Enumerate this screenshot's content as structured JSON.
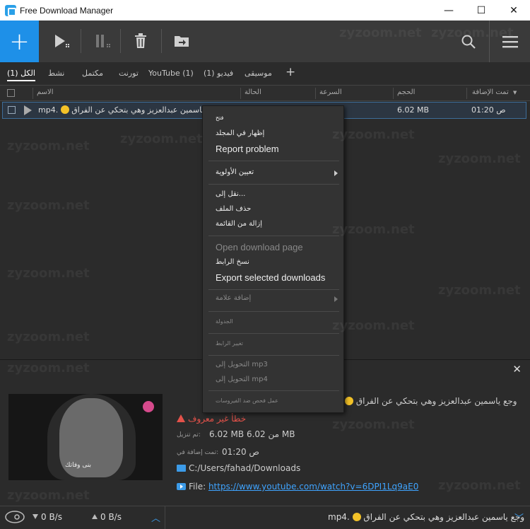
{
  "window": {
    "title": "Free Download Manager",
    "minimize": "—",
    "maximize": "☐",
    "close": "✕"
  },
  "toolbar": {
    "add_label": "+"
  },
  "filters": [
    {
      "label": "الكل (1)",
      "active": true
    },
    {
      "label": "نشط"
    },
    {
      "label": "مكتمل"
    },
    {
      "label": "تورنت"
    },
    {
      "label": "YouTube (1)"
    },
    {
      "label": "(1) فيديو"
    },
    {
      "label": "موسيقى"
    }
  ],
  "filter_add": "+",
  "columns": {
    "name": "الاسم",
    "status": "الحالة",
    "speed": "السرعة",
    "size": "الحجم",
    "added": "تمت الإضافة"
  },
  "row": {
    "name_prefix": "mp4.",
    "name_text": "بع ياسمين عبدالعزيز وهي بتحكي عن الفراق",
    "size": "6.02 MB",
    "added": "01:20 ص"
  },
  "context_menu": {
    "open": "فتح",
    "show_in_folder": "إظهار في المجلد",
    "report_problem": "Report problem",
    "set_priority": "تعيين الأولوية",
    "move_to": "نقل إلى...",
    "delete_file": "حذف الملف",
    "remove_from_list": "إزالة من القائمة",
    "open_download_page": "Open download page",
    "copy_link": "نسخ الرابط",
    "export_selected": "Export selected downloads",
    "add_tag": "إضافة علامة",
    "schedule": "الجدولة",
    "change_link": "تغيير الرابط",
    "convert_mp3": "التحويل إلى mp3",
    "convert_mp4": "التحويل إلى mp4",
    "virus_check": "عمل فحص ضد الفيروسات"
  },
  "details": {
    "title_text": "وجع ياسمين عبدالعزيز وهي بتحكي عن الفراق",
    "close": "✕",
    "error": "خطأ غير معروف",
    "downloaded_label": "تم تنزيل:",
    "downloaded_value": "6.02 MB من 6.02 MB",
    "added_label": "تمت إضافة في:",
    "added_value": "01:20 ص",
    "path": "C:/Users/fahad/Downloads",
    "file_label": "File:",
    "file_url": "https://www.youtube.com/watch?v=6DPI1Lq9aE0",
    "thumb_caption": "بنى وفاتك"
  },
  "statusbar": {
    "down_speed": "0 B/s",
    "up_speed": "0 B/s",
    "current_file_prefix": "mp4.",
    "current_file_text": "وجع ياسمين عبدالعزيز وهي بتحكي عن الفراق"
  },
  "watermark": "zyzoom.net",
  "colors": {
    "accent": "#1e90e8",
    "error": "#e4524a",
    "link": "#3fa4ff"
  }
}
